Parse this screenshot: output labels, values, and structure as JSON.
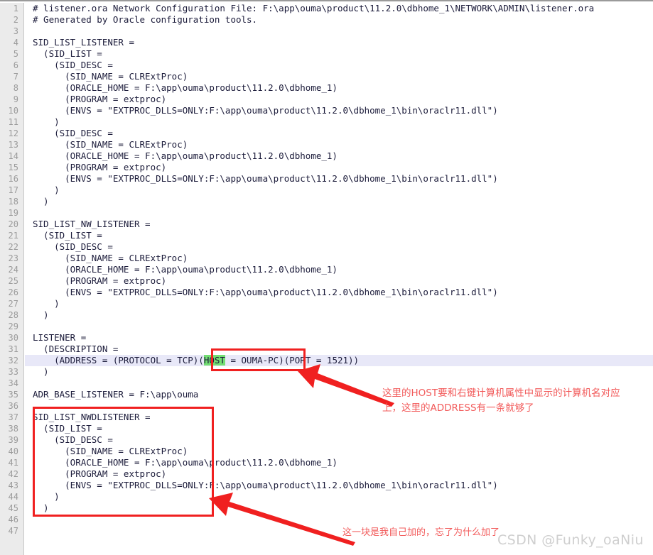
{
  "editor": {
    "gutter_color": "#ebebeb",
    "text_color": "#1b1b3a",
    "line_number_color": "#9b9b9b",
    "highlight_line_color": "#e8e8f8",
    "search_match_color": "#73de73",
    "lines": [
      {
        "n": "1",
        "text": "# listener.ora Network Configuration File: F:\\app\\ouma\\product\\11.2.0\\dbhome_1\\NETWORK\\ADMIN\\listener.ora"
      },
      {
        "n": "2",
        "text": "# Generated by Oracle configuration tools."
      },
      {
        "n": "3",
        "text": ""
      },
      {
        "n": "4",
        "text": "SID_LIST_LISTENER ="
      },
      {
        "n": "5",
        "text": "  (SID_LIST ="
      },
      {
        "n": "6",
        "text": "    (SID_DESC ="
      },
      {
        "n": "7",
        "text": "      (SID_NAME = CLRExtProc)"
      },
      {
        "n": "8",
        "text": "      (ORACLE_HOME = F:\\app\\ouma\\product\\11.2.0\\dbhome_1)"
      },
      {
        "n": "9",
        "text": "      (PROGRAM = extproc)"
      },
      {
        "n": "10",
        "text": "      (ENVS = \"EXTPROC_DLLS=ONLY:F:\\app\\ouma\\product\\11.2.0\\dbhome_1\\bin\\oraclr11.dll\")"
      },
      {
        "n": "11",
        "text": "    )"
      },
      {
        "n": "12",
        "text": "    (SID_DESC ="
      },
      {
        "n": "13",
        "text": "      (SID_NAME = CLRExtProc)"
      },
      {
        "n": "14",
        "text": "      (ORACLE_HOME = F:\\app\\ouma\\product\\11.2.0\\dbhome_1)"
      },
      {
        "n": "15",
        "text": "      (PROGRAM = extproc)"
      },
      {
        "n": "16",
        "text": "      (ENVS = \"EXTPROC_DLLS=ONLY:F:\\app\\ouma\\product\\11.2.0\\dbhome_1\\bin\\oraclr11.dll\")"
      },
      {
        "n": "17",
        "text": "    )"
      },
      {
        "n": "18",
        "text": "  )"
      },
      {
        "n": "19",
        "text": ""
      },
      {
        "n": "20",
        "text": "SID_LIST_NW_LISTENER ="
      },
      {
        "n": "21",
        "text": "  (SID_LIST ="
      },
      {
        "n": "22",
        "text": "    (SID_DESC ="
      },
      {
        "n": "23",
        "text": "      (SID_NAME = CLRExtProc)"
      },
      {
        "n": "24",
        "text": "      (ORACLE_HOME = F:\\app\\ouma\\product\\11.2.0\\dbhome_1)"
      },
      {
        "n": "25",
        "text": "      (PROGRAM = extproc)"
      },
      {
        "n": "26",
        "text": "      (ENVS = \"EXTPROC_DLLS=ONLY:F:\\app\\ouma\\product\\11.2.0\\dbhome_1\\bin\\oraclr11.dll\")"
      },
      {
        "n": "27",
        "text": "    )"
      },
      {
        "n": "28",
        "text": "  )"
      },
      {
        "n": "29",
        "text": ""
      },
      {
        "n": "30",
        "text": "LISTENER ="
      },
      {
        "n": "31",
        "text": "  (DESCRIPTION ="
      },
      {
        "n": "32",
        "text": "    (ADDRESS = (PROTOCOL = TCP)(HOST = OUMA-PC)(PORT = 1521))",
        "highlight": true,
        "match": {
          "before": "    (ADDRESS = (PROTOCOL = TCP)(",
          "hit": "HOST",
          "after": " = OUMA-PC)(PORT = 1521))"
        }
      },
      {
        "n": "33",
        "text": "  )"
      },
      {
        "n": "34",
        "text": ""
      },
      {
        "n": "35",
        "text": "ADR_BASE_LISTENER = F:\\app\\ouma"
      },
      {
        "n": "36",
        "text": ""
      },
      {
        "n": "37",
        "text": "SID_LIST_NWDLISTENER ="
      },
      {
        "n": "38",
        "text": "  (SID_LIST ="
      },
      {
        "n": "39",
        "text": "    (SID_DESC ="
      },
      {
        "n": "40",
        "text": "      (SID_NAME = CLRExtProc)"
      },
      {
        "n": "41",
        "text": "      (ORACLE_HOME = F:\\app\\ouma\\product\\11.2.0\\dbhome_1)"
      },
      {
        "n": "42",
        "text": "      (PROGRAM = extproc)"
      },
      {
        "n": "43",
        "text": "      (ENVS = \"EXTPROC_DLLS=ONLY:F:\\app\\ouma\\product\\11.2.0\\dbhome_1\\bin\\oraclr11.dll\")"
      },
      {
        "n": "44",
        "text": "    )"
      },
      {
        "n": "45",
        "text": "  )"
      },
      {
        "n": "46",
        "text": ""
      },
      {
        "n": "47",
        "text": ""
      }
    ]
  },
  "annotations": {
    "color": "#f25a5a",
    "host_note": "这里的HOST要和右键计算机属性中显示的计算机名对应\n上，这里的ADDRESS有一条就够了",
    "nwd_note": "这一块是我自己加的，忘了为什么加了"
  },
  "watermark": {
    "text": "CSDN @Funky_oaNiu"
  }
}
